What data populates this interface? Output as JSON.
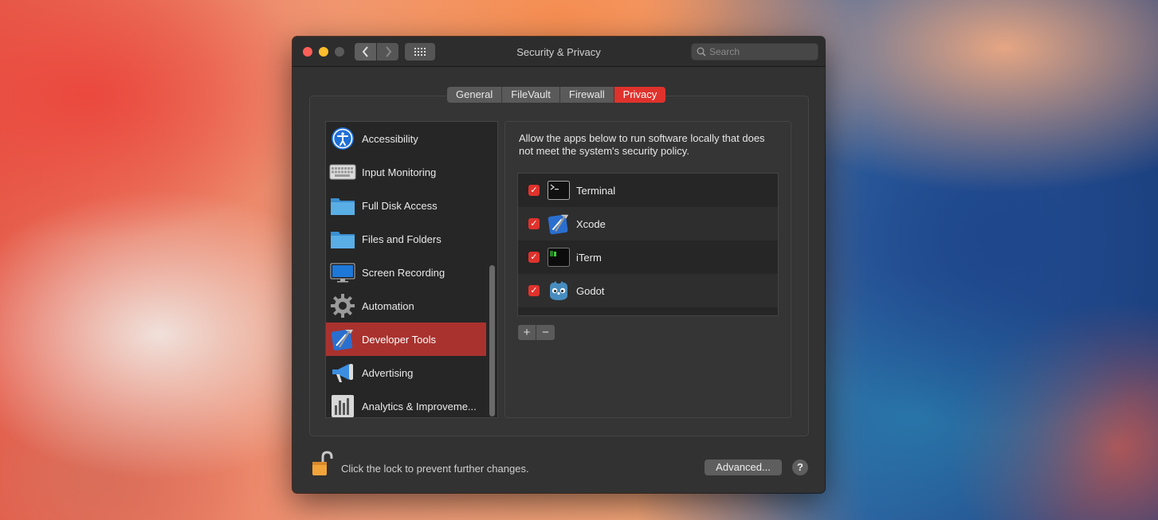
{
  "window": {
    "title": "Security & Privacy"
  },
  "search": {
    "placeholder": "Search",
    "icon": "magnifier-icon"
  },
  "tabs": [
    {
      "label": "General",
      "active": false
    },
    {
      "label": "FileVault",
      "active": false
    },
    {
      "label": "Firewall",
      "active": false
    },
    {
      "label": "Privacy",
      "active": true
    }
  ],
  "sidebar": {
    "items": [
      {
        "label": "Accessibility",
        "icon": "accessibility-icon"
      },
      {
        "label": "Input Monitoring",
        "icon": "keyboard-icon"
      },
      {
        "label": "Full Disk Access",
        "icon": "folder-icon"
      },
      {
        "label": "Files and Folders",
        "icon": "folder-icon"
      },
      {
        "label": "Screen Recording",
        "icon": "display-icon"
      },
      {
        "label": "Automation",
        "icon": "gear-icon"
      },
      {
        "label": "Developer Tools",
        "icon": "xcode-icon",
        "selected": true
      },
      {
        "label": "Advertising",
        "icon": "megaphone-icon"
      },
      {
        "label": "Analytics & Improveme...",
        "icon": "bar-chart-icon"
      }
    ]
  },
  "panel": {
    "description": "Allow the apps below to run software locally that does not meet the system's security policy.",
    "apps": [
      {
        "name": "Terminal",
        "checked": true,
        "icon": "terminal-icon"
      },
      {
        "name": "Xcode",
        "checked": true,
        "icon": "xcode-icon"
      },
      {
        "name": "iTerm",
        "checked": true,
        "icon": "iterm-icon"
      },
      {
        "name": "Godot",
        "checked": true,
        "icon": "godot-icon"
      }
    ],
    "add_label": "+",
    "remove_label": "−",
    "check_mark": "✓"
  },
  "footer": {
    "lock_text": "Click the lock to prevent further changes.",
    "advanced_label": "Advanced...",
    "help_label": "?"
  },
  "colors": {
    "accent": "#e0322c",
    "selected_row": "#a9322e",
    "window_bg": "#323232"
  }
}
